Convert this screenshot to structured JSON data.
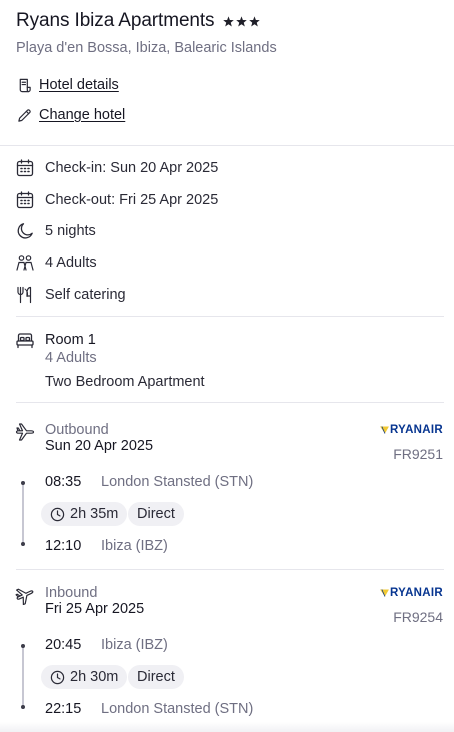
{
  "hotel": {
    "name": "Ryans Ibiza Apartments",
    "stars": 3,
    "location": "Playa d'en Bossa, Ibiza, Balearic Islands"
  },
  "links": {
    "details": {
      "label": "Hotel details",
      "icon": "document-icon"
    },
    "change": {
      "label": "Change hotel",
      "icon": "pencil-icon"
    }
  },
  "stay": {
    "check_in": "Check-in: Sun 20 Apr 2025",
    "check_out": "Check-out: Fri 25 Apr 2025",
    "nights": "5 nights",
    "guests": "4 Adults",
    "board": "Self catering"
  },
  "room": {
    "title": "Room 1",
    "adults": "4 Adults",
    "type": "Two Bedroom Apartment"
  },
  "outbound": {
    "direction": "Outbound",
    "date": "Sun 20 Apr 2025",
    "airline": "RYANAIR",
    "flight_no": "FR9251",
    "depart_time": "08:35",
    "depart_place": "London Stansted (STN)",
    "duration": "2h 35m",
    "stops": "Direct",
    "arrive_time": "12:10",
    "arrive_place": "Ibiza (IBZ)"
  },
  "inbound": {
    "direction": "Inbound",
    "date": "Fri 25 Apr 2025",
    "airline": "RYANAIR",
    "flight_no": "FR9254",
    "depart_time": "20:45",
    "depart_place": "Ibiza (IBZ)",
    "duration": "2h 30m",
    "stops": "Direct",
    "arrive_time": "22:15",
    "arrive_place": "London Stansted (STN)"
  },
  "colors": {
    "text": "#161622",
    "muted": "#6f6f82",
    "chip_bg": "#f0f0f4",
    "divider": "#e6e6ec",
    "ryanair_blue": "#073590",
    "ryanair_gold": "#f1c933"
  }
}
